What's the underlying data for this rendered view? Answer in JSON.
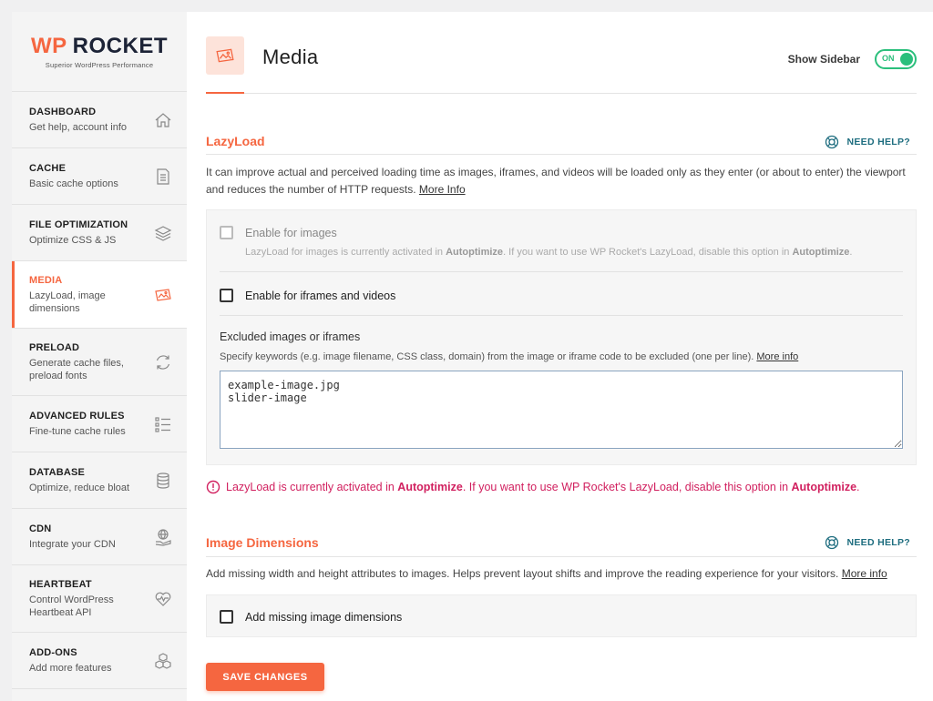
{
  "brand": {
    "name_wp": "WP",
    "name_rocket": "ROCKET",
    "tagline": "Superior WordPress Performance",
    "accent": "#f56640"
  },
  "sidebar": {
    "items": [
      {
        "title": "DASHBOARD",
        "desc": "Get help, account info",
        "icon": "home-icon"
      },
      {
        "title": "CACHE",
        "desc": "Basic cache options",
        "icon": "document-icon"
      },
      {
        "title": "FILE OPTIMIZATION",
        "desc": "Optimize CSS & JS",
        "icon": "layers-icon"
      },
      {
        "title": "MEDIA",
        "desc": "LazyLoad, image dimensions",
        "icon": "image-icon",
        "active": true
      },
      {
        "title": "PRELOAD",
        "desc": "Generate cache files, preload fonts",
        "icon": "refresh-icon"
      },
      {
        "title": "ADVANCED RULES",
        "desc": "Fine-tune cache rules",
        "icon": "list-icon"
      },
      {
        "title": "DATABASE",
        "desc": "Optimize, reduce bloat",
        "icon": "database-icon"
      },
      {
        "title": "CDN",
        "desc": "Integrate your CDN",
        "icon": "globe-hand-icon"
      },
      {
        "title": "HEARTBEAT",
        "desc": "Control WordPress Heartbeat API",
        "icon": "heart-pulse-icon"
      },
      {
        "title": "ADD-ONS",
        "desc": "Add more features",
        "icon": "cubes-icon"
      }
    ]
  },
  "header": {
    "title": "Media",
    "show_sidebar_label": "Show Sidebar",
    "toggle_state": "ON"
  },
  "lazyload": {
    "title": "LazyLoad",
    "help": "NEED HELP?",
    "description": "It can improve actual and perceived loading time as images, iframes, and videos will be loaded only as they enter (or about to enter) the viewport and reduces the number of HTTP requests.",
    "more_info": "More Info",
    "enable_images_label": "Enable for images",
    "enable_images_note_pre": "LazyLoad for images is currently activated in ",
    "enable_images_note_plugin": "Autoptimize",
    "enable_images_note_mid": ". If you want to use WP Rocket's LazyLoad, disable this option in ",
    "enable_images_note_end": ".",
    "enable_iframes_label": "Enable for iframes and videos",
    "excluded_label": "Excluded images or iframes",
    "excluded_desc": "Specify keywords (e.g. image filename, CSS class, domain) from the image or iframe code to be excluded (one per line).",
    "excluded_more_info": "More info",
    "excluded_value": "example-image.jpg\nslider-image",
    "warning_pre": "LazyLoad is currently activated in ",
    "warning_plugin": "Autoptimize",
    "warning_mid": ". If you want to use WP Rocket's LazyLoad, disable this option in ",
    "warning_end": "."
  },
  "image_dimensions": {
    "title": "Image Dimensions",
    "help": "NEED HELP?",
    "description": "Add missing width and height attributes to images. Helps prevent layout shifts and improve the reading experience for your visitors.",
    "more_info": "More info",
    "add_missing_label": "Add missing image dimensions"
  },
  "actions": {
    "save_label": "SAVE CHANGES"
  }
}
